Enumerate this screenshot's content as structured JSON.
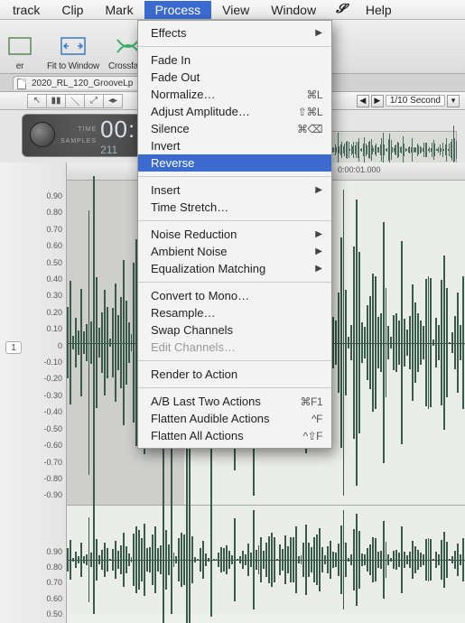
{
  "menubar": {
    "items": [
      "track",
      "Clip",
      "Mark",
      "Process",
      "View",
      "Window",
      "Help"
    ],
    "active_index": 3
  },
  "toolbar": {
    "fit_window": "Fit to Window",
    "crossfade": "Crossfade"
  },
  "tab": {
    "filename": "2020_RL_120_GrooveLp"
  },
  "time_controls": {
    "unit_label": "1/10 Second"
  },
  "counter": {
    "time_label": "TIME",
    "samples_label": "SAMPLES",
    "time_value": "00:",
    "samples_value": "211"
  },
  "ruler": {
    "t1": "0:00:01.000"
  },
  "axis": {
    "top": [
      "0.90",
      "0.80",
      "0.70",
      "0.60",
      "0.50",
      "0.40",
      "0.30",
      "0.20",
      "0.10",
      "0",
      "-0.10",
      "-0.20",
      "-0.30",
      "-0.40",
      "-0.50",
      "-0.60",
      "-0.70",
      "-0.80",
      "-0.90"
    ],
    "bottom": [
      "0.90",
      "0.80",
      "0.70",
      "0.60",
      "0.50"
    ]
  },
  "track_number": "1",
  "menu": {
    "groups": [
      [
        {
          "label": "Effects",
          "submenu": true
        }
      ],
      [
        {
          "label": "Fade In"
        },
        {
          "label": "Fade Out"
        },
        {
          "label": "Normalize…",
          "shortcut": "⌘L"
        },
        {
          "label": "Adjust Amplitude…",
          "shortcut": "⇧⌘L"
        },
        {
          "label": "Silence",
          "shortcut": "⌘⌫"
        },
        {
          "label": "Invert"
        },
        {
          "label": "Reverse",
          "highlight": true
        }
      ],
      [
        {
          "label": "Insert",
          "submenu": true
        },
        {
          "label": "Time Stretch…"
        }
      ],
      [
        {
          "label": "Noise Reduction",
          "submenu": true
        },
        {
          "label": "Ambient Noise",
          "submenu": true
        },
        {
          "label": "Equalization Matching",
          "submenu": true
        }
      ],
      [
        {
          "label": "Convert to Mono…"
        },
        {
          "label": "Resample…"
        },
        {
          "label": "Swap Channels"
        },
        {
          "label": "Edit Channels…",
          "disabled": true
        }
      ],
      [
        {
          "label": "Render to Action"
        }
      ],
      [
        {
          "label": "A/B Last Two Actions",
          "shortcut": "⌘F1"
        },
        {
          "label": "Flatten Audible Actions",
          "shortcut": "^F"
        },
        {
          "label": "Flatten All Actions",
          "shortcut": "^⇧F"
        }
      ]
    ]
  }
}
